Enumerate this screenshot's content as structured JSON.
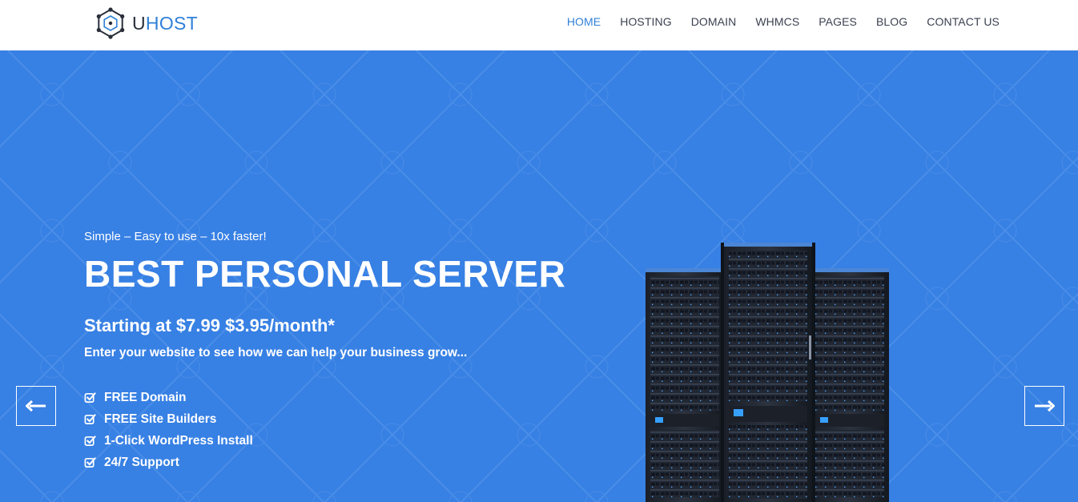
{
  "brand": {
    "name_part1": "U",
    "name_part2": "HOST",
    "logo_icon": "hexagon-network-icon",
    "accent": "#2f80d8"
  },
  "nav": {
    "items": [
      {
        "label": "HOME",
        "active": true
      },
      {
        "label": "HOSTING",
        "active": false
      },
      {
        "label": "DOMAIN",
        "active": false
      },
      {
        "label": "WHMCS",
        "active": false
      },
      {
        "label": "PAGES",
        "active": false
      },
      {
        "label": "BLOG",
        "active": false
      },
      {
        "label": "CONTACT US",
        "active": false
      }
    ]
  },
  "hero": {
    "background": "#3780e4",
    "subtitle": "Simple – Easy to use – 10x faster!",
    "title": "BEST PERSONAL SERVER",
    "price_line": "Starting at $7.99 $3.95/month*",
    "tagline": "Enter your website to see how we can help your business grow...",
    "features": [
      {
        "label": "FREE Domain",
        "icon": "check-square-icon"
      },
      {
        "label": "FREE Site Builders",
        "icon": "check-square-icon"
      },
      {
        "label": "1-Click WordPress Install",
        "icon": "check-square-icon"
      },
      {
        "label": "24/7 Support",
        "icon": "check-square-icon"
      }
    ],
    "image": "server-racks-image"
  },
  "slider": {
    "prev_icon": "arrow-left-icon",
    "next_icon": "arrow-right-icon"
  }
}
